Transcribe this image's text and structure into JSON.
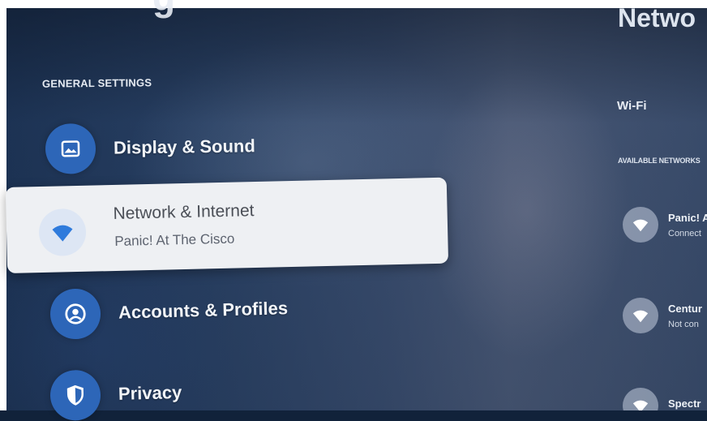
{
  "left_panel": {
    "title_fragment": "g",
    "section_header": "GENERAL SETTINGS",
    "items": [
      {
        "label": "Display & Sound",
        "icon": "image-icon"
      },
      {
        "label": "Network & Internet",
        "subtitle": "Panic! At The Cisco",
        "icon": "wifi-icon",
        "selected": true
      },
      {
        "label": "Accounts & Profiles",
        "icon": "account-icon"
      },
      {
        "label": "Privacy",
        "icon": "shield-icon"
      }
    ]
  },
  "right_panel": {
    "title": "Netwo",
    "wifi_label": "Wi-Fi",
    "available_header": "AVAILABLE NETWORKS",
    "networks": [
      {
        "name": "Panic! A",
        "status": "Connect"
      },
      {
        "name": "Centur",
        "status": "Not con"
      },
      {
        "name": "Spectr",
        "status": ""
      }
    ]
  },
  "colors": {
    "accent_blue": "#2d66b8",
    "selected_card": "#eef0f3",
    "selected_icon_bg": "#dde6f4",
    "wifi_selected": "#2f7bdc"
  }
}
